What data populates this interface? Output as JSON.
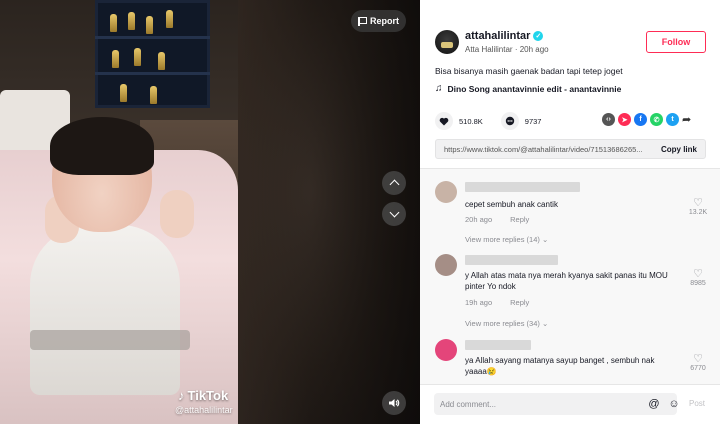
{
  "video": {
    "report_label": "Report",
    "watermark_brand": "TikTok",
    "watermark_handle": "@attahalilintar",
    "nav_up_icon": "chevron-up-icon",
    "nav_down_icon": "chevron-down-icon",
    "volume_icon": "volume-icon"
  },
  "author": {
    "username": "attahalilintar",
    "display_name": "Atta Halilintar",
    "time_ago": "20h ago",
    "verified": true,
    "follow_label": "Follow"
  },
  "post": {
    "caption": "Bisa bisanya masih gaenak badan tapi tetep joget",
    "music": "Dino Song anantavinnie edit - anantavinnie",
    "likes": "510.8K",
    "comments": "9737",
    "link": "https://www.tiktok.com/@attahalilintar/video/71513686265...",
    "copy_label": "Copy link",
    "share_icons": [
      "embed-icon",
      "send-icon",
      "facebook-icon",
      "whatsapp-icon",
      "twitter-icon",
      "share-arrow-icon"
    ]
  },
  "comments": [
    {
      "text": "cepet sembuh anak cantik",
      "time": "20h ago",
      "reply_label": "Reply",
      "likes": "13.2K",
      "more_replies": "View more replies (14)",
      "avatar_color": "#c8b3a6"
    },
    {
      "text": "y Allah atas mata nya merah kyanya sakit panas itu MOU pinter Yo ndok",
      "time": "19h ago",
      "reply_label": "Reply",
      "likes": "8985",
      "more_replies": "View more replies (34)",
      "avatar_color": "#a58e86"
    },
    {
      "text": "ya Allah sayang matanya sayup banget , sembuh nak yaaaa😢",
      "likes": "6770",
      "avatar_color": "#e4457a"
    }
  ],
  "composer": {
    "placeholder": "Add comment...",
    "post_label": "Post"
  },
  "colors": {
    "accent": "#fe2c55",
    "verified": "#20d5ec"
  }
}
